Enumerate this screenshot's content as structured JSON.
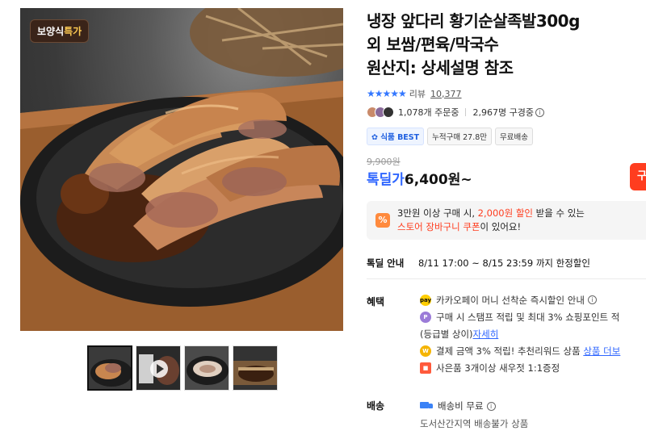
{
  "gallery": {
    "badge_prefix": "보양식",
    "badge_highlight": "특가",
    "thumbnails": [
      {
        "name": "thumbnail-1",
        "active": true
      },
      {
        "name": "thumbnail-2-video",
        "active": false
      },
      {
        "name": "thumbnail-3",
        "active": false
      },
      {
        "name": "thumbnail-4",
        "active": false
      }
    ]
  },
  "product": {
    "title_line1": "냉장 앞다리 황기순살족발300g",
    "title_line2": "외 보쌈/편육/막국수",
    "title_line3": "원산지: 상세설명 참조",
    "stars": "★★★★★",
    "review_label": "리뷰",
    "review_count": "10,377",
    "order_count": "1,078개 주문중",
    "subscriber_count": "2,967명 구경중",
    "tags": [
      "식품 BEST",
      "누적구매 27.8만",
      "무료배송"
    ],
    "original_price": "9,900원",
    "price_label": "톡딜가",
    "price_value": "6,400원~",
    "buy_button_label": "구"
  },
  "coupon": {
    "icon": "%",
    "line1_a": "3만원 이상 구매 시, ",
    "line1_red": "2,000원 할인",
    "line1_b": " 받을 수 있는",
    "line2_red": "스토어 장바구니 쿠폰",
    "line2_b": "이 있어요!"
  },
  "deal": {
    "label": "톡딜 안내",
    "period": "8/11 17:00 ~ 8/15 23:59 까지 한정할인"
  },
  "benefits": {
    "label": "혜택",
    "items": [
      {
        "text": "카카오페이 머니 선착순 즉시할인 안내",
        "icon": "pay-icon",
        "color": "#ffcd00"
      },
      {
        "text": "구매 시 스탬프 적립 및 최대 3% 쇼핑포인트 적",
        "icon": "point-icon",
        "color": "#9b7bd8"
      },
      {
        "text": "결제 금액 3% 적립! 추천리워드 상품",
        "link": "상품 더보",
        "icon": "reward-icon",
        "color": "#f5b400"
      },
      {
        "text": "사은품 3개이상 새우젓 1:1증정",
        "icon": "gift-icon",
        "color": "#ff5a3c"
      }
    ],
    "sub_text": "(등급별 상이) ",
    "sub_link": "자세히"
  },
  "shipping": {
    "label": "배송",
    "line1": "배송비 무료",
    "line2": "도서산간지역 배송불가 상품"
  }
}
